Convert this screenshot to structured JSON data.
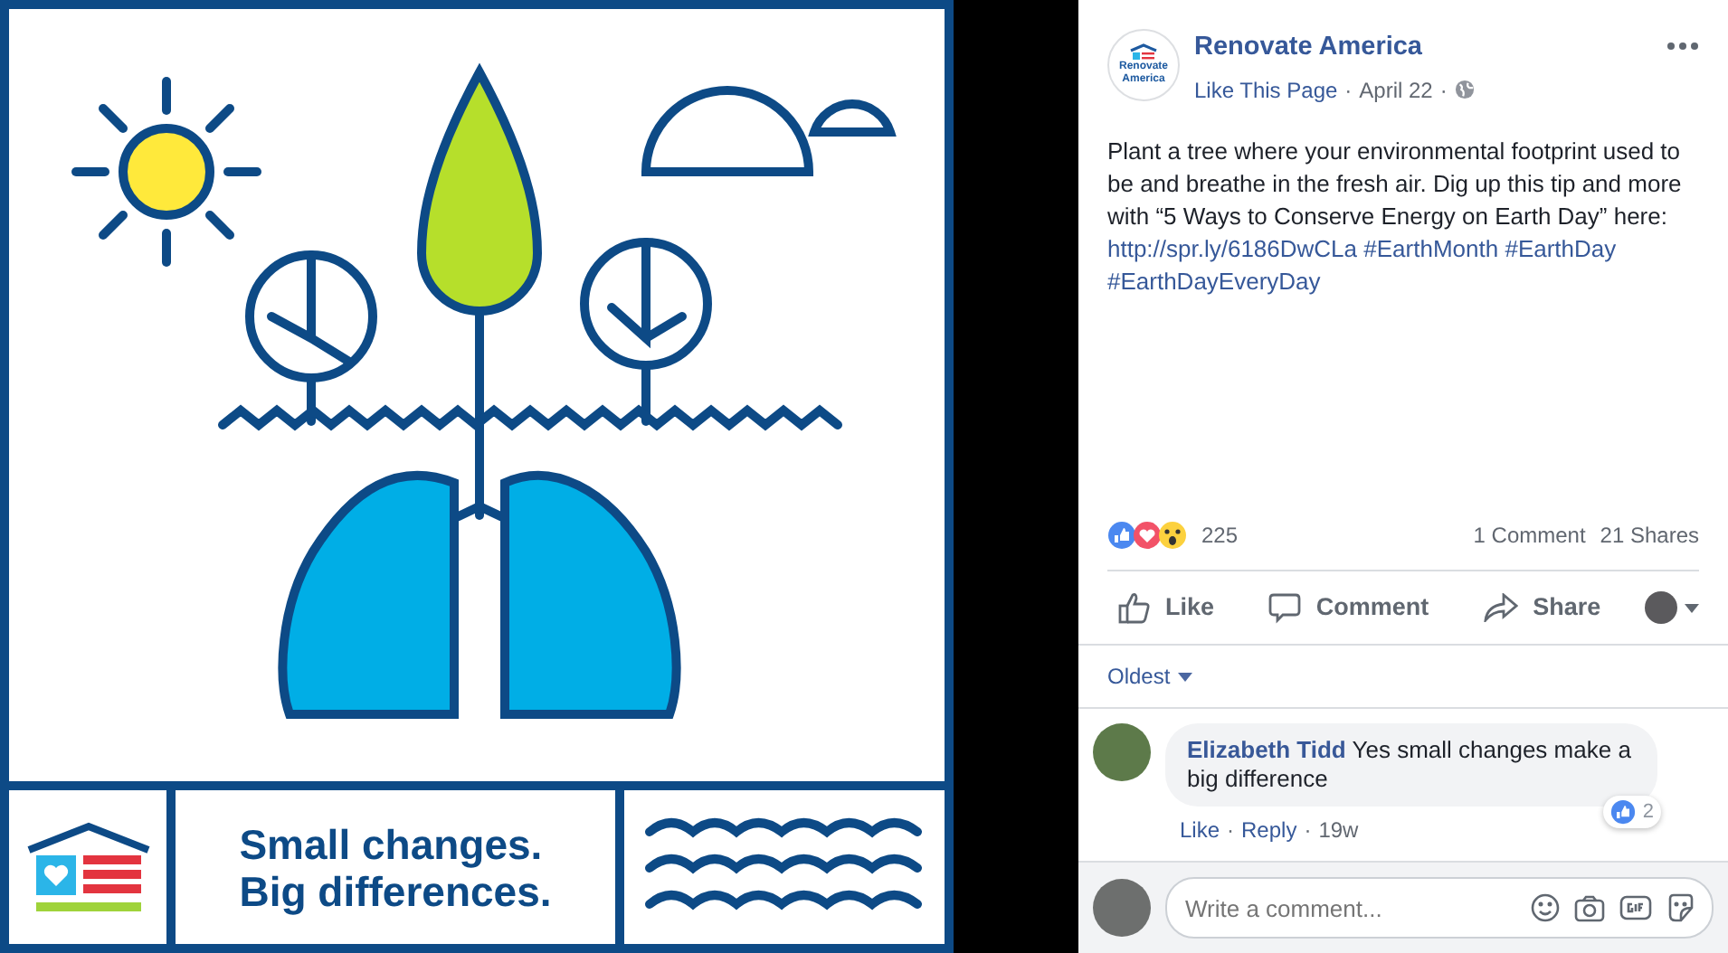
{
  "post_image": {
    "headline_lines": [
      "Small changes.",
      "Big differences."
    ]
  },
  "post": {
    "avatar_text": "Renovate America",
    "page_name": "Renovate America",
    "like_page": "Like This Page",
    "date": "April 22",
    "body": [
      {
        "kind": "text",
        "text": "Plant a tree where your environmental footprint used to be and breathe in the fresh air. Dig up this tip and more with “5 Ways to Conserve Energy on Earth Day” here: "
      },
      {
        "kind": "link",
        "text": "http://spr.ly/6186DwCLa"
      },
      {
        "kind": "link",
        "text": "#EarthMonth"
      },
      {
        "kind": "link",
        "text": "#EarthDay"
      },
      {
        "kind": "link",
        "text": "#EarthDayEveryDay"
      }
    ],
    "meta_separators": [
      "·",
      "·"
    ],
    "reaction_count": "225",
    "comment_count": "1 Comment",
    "share_count": "21 Shares",
    "actions": [
      {
        "kind": "like",
        "label": "Like"
      },
      {
        "kind": "comment",
        "label": "Comment"
      },
      {
        "kind": "share",
        "label": "Share"
      }
    ]
  },
  "comments": {
    "sort": "Oldest",
    "items": [
      {
        "author": "Elizabeth Tidd",
        "text": "Yes small changes make a big difference",
        "like": "Like",
        "reply": "Reply",
        "age": "19w",
        "separators": [
          "·",
          "·"
        ],
        "reaction_count": "2"
      }
    ],
    "composer": {
      "placeholder": "Write a comment..."
    }
  }
}
